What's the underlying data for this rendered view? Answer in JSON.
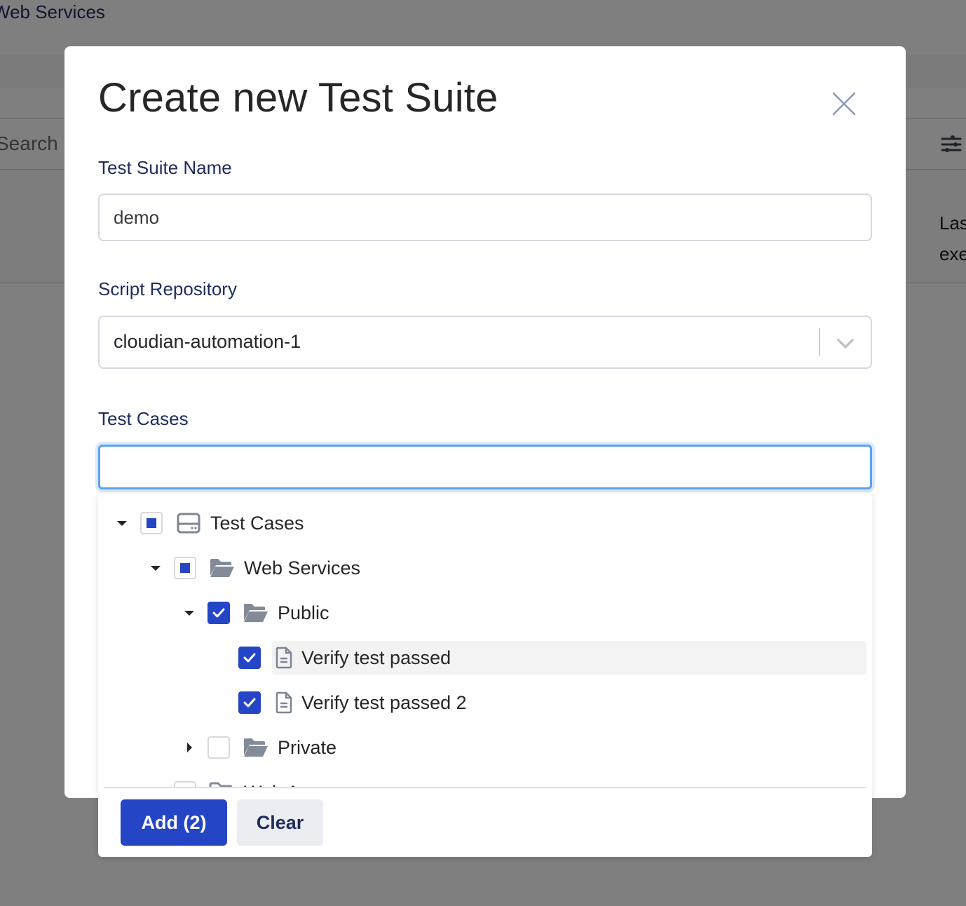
{
  "background": {
    "breadcrumb": "Web Services",
    "search_placeholder": "Search by",
    "column_header": "Last executed"
  },
  "modal": {
    "title": "Create new Test Suite",
    "close_icon": "close-icon",
    "fields": {
      "name": {
        "label": "Test Suite Name",
        "value": "demo"
      },
      "repository": {
        "label": "Script Repository",
        "value": "cloudian-automation-1"
      },
      "test_cases": {
        "label": "Test Cases",
        "value": "",
        "placeholder": ""
      }
    }
  },
  "tree": {
    "nodes": [
      {
        "label": "Test Cases",
        "icon": "repository-icon",
        "state": "partial",
        "expanded": true,
        "level": 0
      },
      {
        "label": "Web Services",
        "icon": "folder-open-icon",
        "state": "partial",
        "expanded": true,
        "level": 1
      },
      {
        "label": "Public",
        "icon": "folder-open-icon",
        "state": "checked",
        "expanded": true,
        "level": 2
      },
      {
        "label": "Verify test passed",
        "icon": "file-icon",
        "state": "checked",
        "level": 3,
        "highlighted": true
      },
      {
        "label": "Verify test passed 2",
        "icon": "file-icon",
        "state": "checked",
        "level": 3
      },
      {
        "label": "Private",
        "icon": "folder-open-icon",
        "state": "unchecked",
        "expanded": false,
        "level": 2
      },
      {
        "label": "Web A...",
        "icon": "folder-open-icon",
        "state": "unchecked",
        "level": 1,
        "clipped": true
      }
    ]
  },
  "footer": {
    "add_label": "Add (2)",
    "clear_label": "Clear"
  },
  "colors": {
    "primary": "#2445c5",
    "label": "#1f2d5c",
    "focus": "#5aa2f2"
  }
}
